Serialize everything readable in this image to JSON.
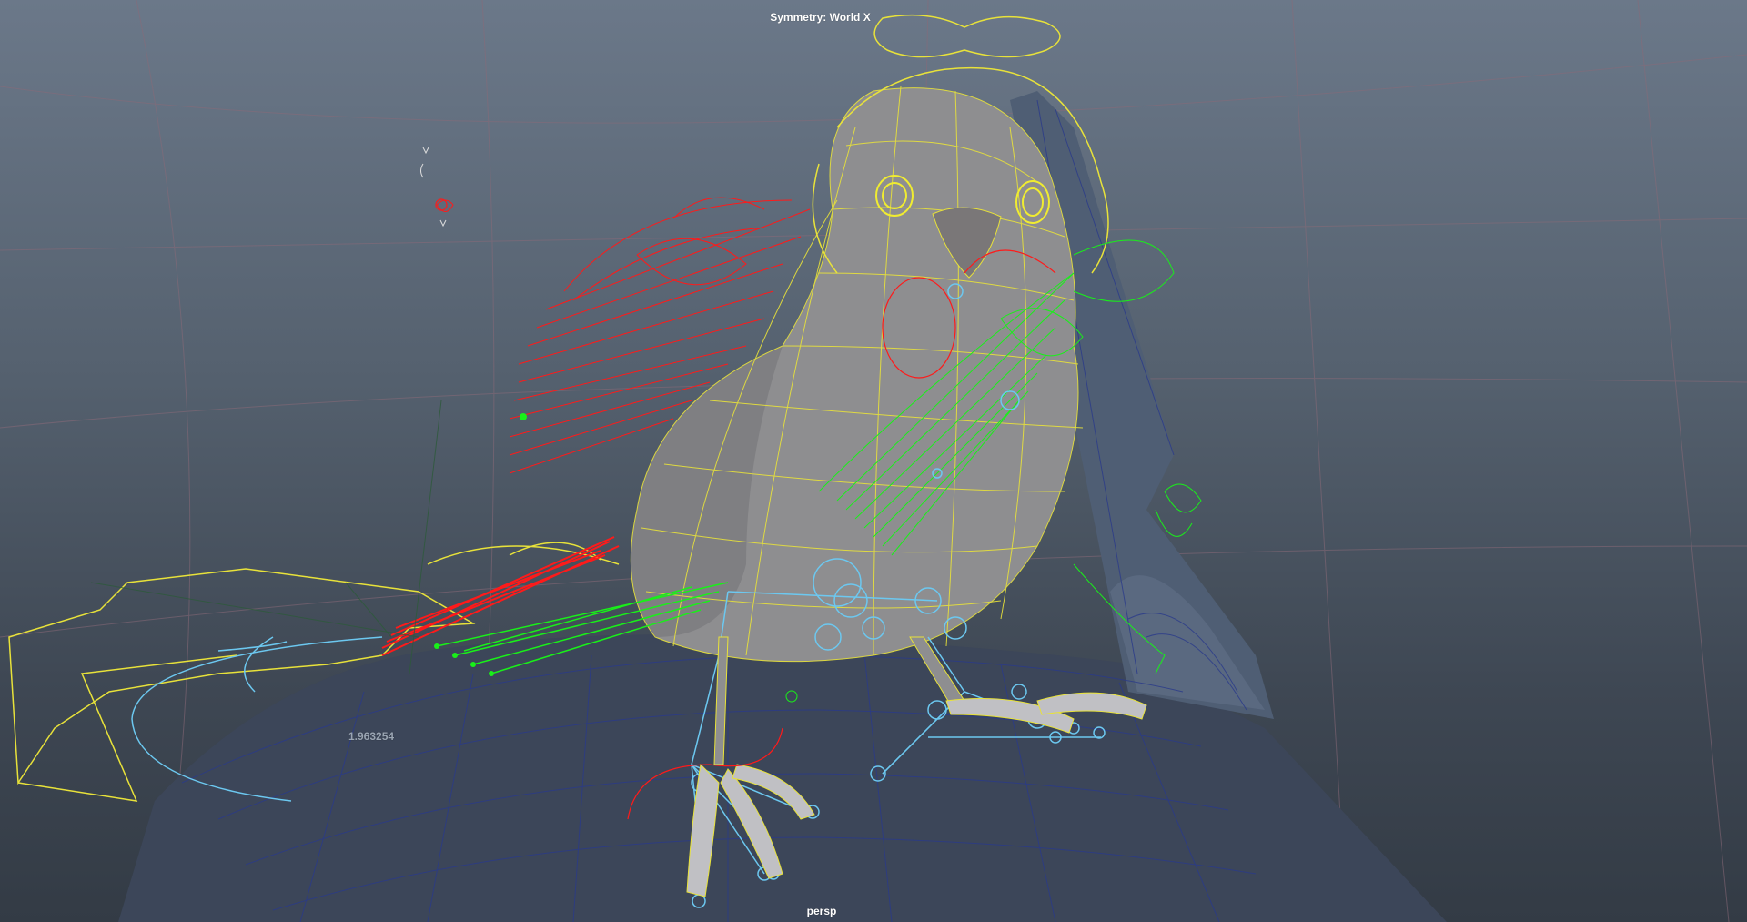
{
  "viewport": {
    "symmetry_label": "Symmetry: World X",
    "camera_label": "persp",
    "measure_value": "1.963254"
  },
  "colors": {
    "background_top": "#6b7889",
    "background_bottom": "#333b45",
    "grid": "#8a6a78",
    "mesh_body": "#8e8e90",
    "wireframe_yellow": "#e8e23a",
    "controls_red": "#ff1a1a",
    "controls_green": "#19f019",
    "joints_cyan": "#6cc8f0",
    "perch_wire": "#2a3a8a"
  },
  "icons": {
    "left_wing_controls": "red-wing-feather-controls",
    "right_wing_controls": "green-wing-feather-controls",
    "skeleton": "cyan-joint-skeleton"
  }
}
